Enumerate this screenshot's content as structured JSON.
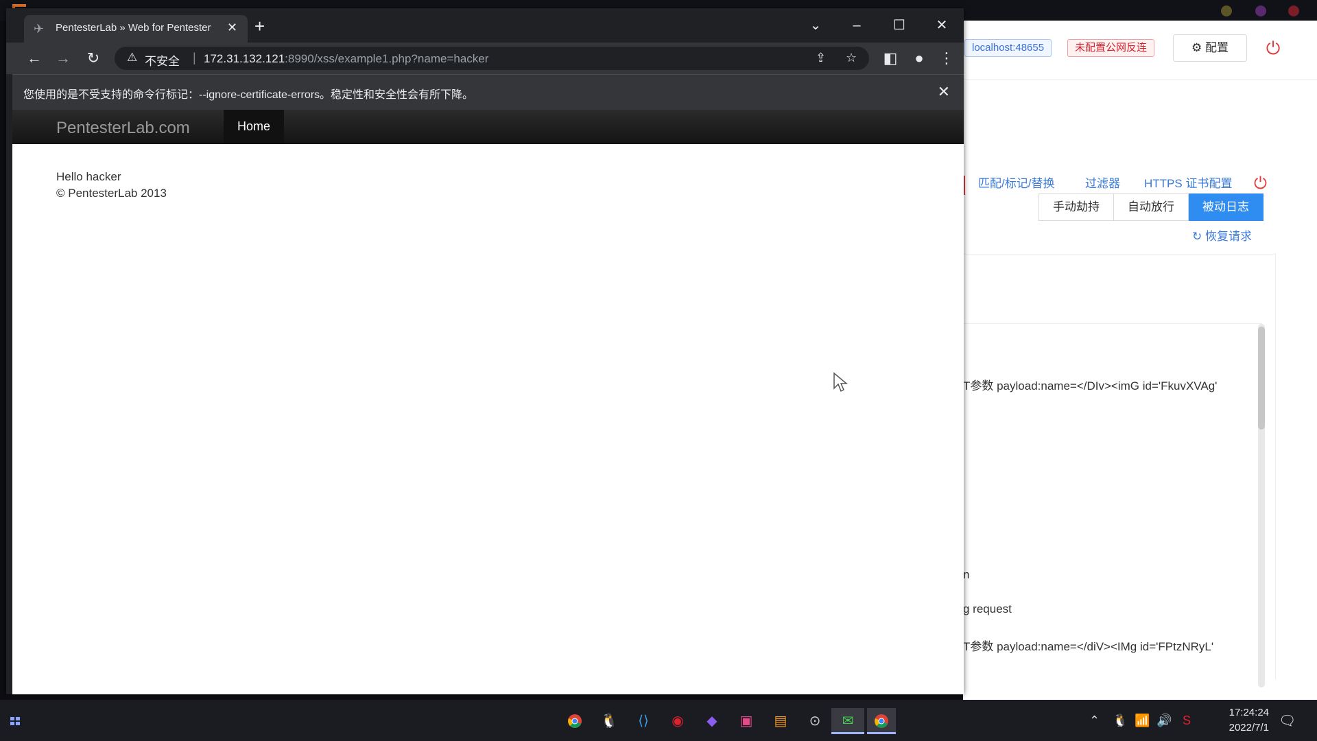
{
  "browser": {
    "tab_title": "PentesterLab » Web for Pentester",
    "security_label": "不安全",
    "url_host": "172.31.132.121",
    "url_rest": ":8990/xss/example1.php?name=hacker",
    "infobar_text": "您使用的是不受支持的命令行标记：--ignore-certificate-errors。稳定性和安全性会有所下降。"
  },
  "site": {
    "brand": "PentesterLab.com",
    "nav_home": "Home",
    "greeting": "Hello hacker",
    "footer": "© PentesterLab 2013"
  },
  "bg_app": {
    "tag_localhost": "localhost:48655",
    "tag_public": "未配置公网反连",
    "config_label": "配置",
    "tabs": [
      "匹配/标记/替换",
      "过滤器",
      "HTTPS 证书配置"
    ],
    "modes": [
      "手动劫持",
      "自动放行",
      "被动日志"
    ],
    "active_mode": "被动日志",
    "restore_label": "恢复请求",
    "log_lines": [
      "T参数 payload:name=</DIv><imG id='FkuvXVAg'",
      "n",
      "g request",
      "T参数 payload:name=</diV><IMg id='FPtzNRyL'"
    ]
  },
  "taskbar": {
    "time": "17:24:24",
    "date": "2022/7/1",
    "apps": [
      "chrome-icon",
      "qq-icon",
      "vscode-icon",
      "netease-music-icon",
      "obsidian-icon",
      "jetbrains-icon",
      "sublime-icon",
      "steam-icon",
      "wechat-icon",
      "chrome-icon"
    ]
  },
  "colors": {
    "accent_blue": "#2f8cf0",
    "danger_red": "#e5393c",
    "chrome_dark": "#202124"
  }
}
